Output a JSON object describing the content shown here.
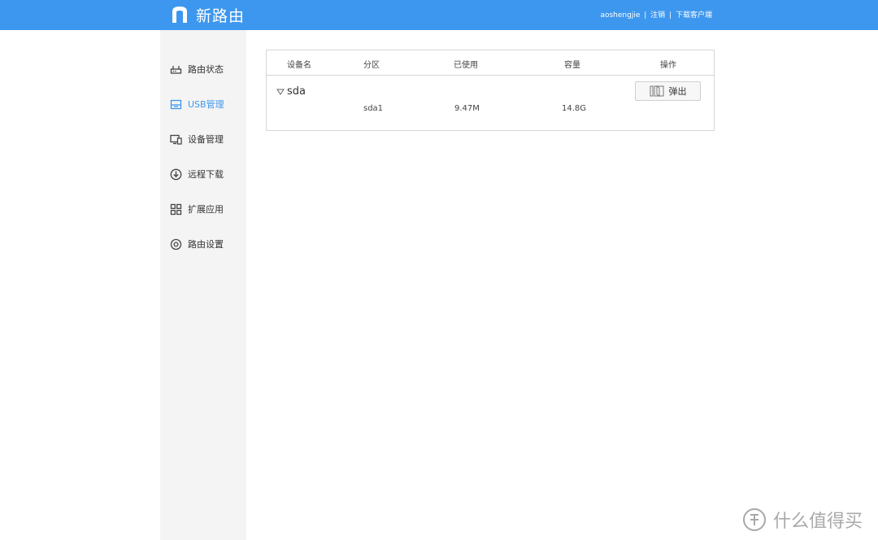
{
  "header": {
    "brand": "新路由",
    "username": "aoshengjie",
    "separator": "|",
    "logout_label": "注销",
    "download_client_label": "下载客户端"
  },
  "sidebar": {
    "items": [
      {
        "label": "路由状态",
        "icon": "router-icon",
        "active": false
      },
      {
        "label": "USB管理",
        "icon": "usb-icon",
        "active": true
      },
      {
        "label": "设备管理",
        "icon": "devices-icon",
        "active": false
      },
      {
        "label": "远程下载",
        "icon": "download-icon",
        "active": false
      },
      {
        "label": "扩展应用",
        "icon": "apps-grid-icon",
        "active": false
      },
      {
        "label": "路由设置",
        "icon": "settings-gear-icon",
        "active": false
      }
    ]
  },
  "usb_table": {
    "headers": {
      "device_name": "设备名",
      "partition": "分区",
      "used": "已使用",
      "capacity": "容量",
      "action": "操作"
    },
    "devices": [
      {
        "name": "sda",
        "eject_label": "弹出",
        "partitions": [
          {
            "partition": "sda1",
            "used": "9.47M",
            "capacity": "14.8G"
          }
        ]
      }
    ]
  },
  "colors": {
    "accent": "#3d97ee",
    "sidebar_bg": "#f4f4f4",
    "border": "#d6d6d6"
  },
  "watermark": {
    "text": "什么值得买"
  }
}
